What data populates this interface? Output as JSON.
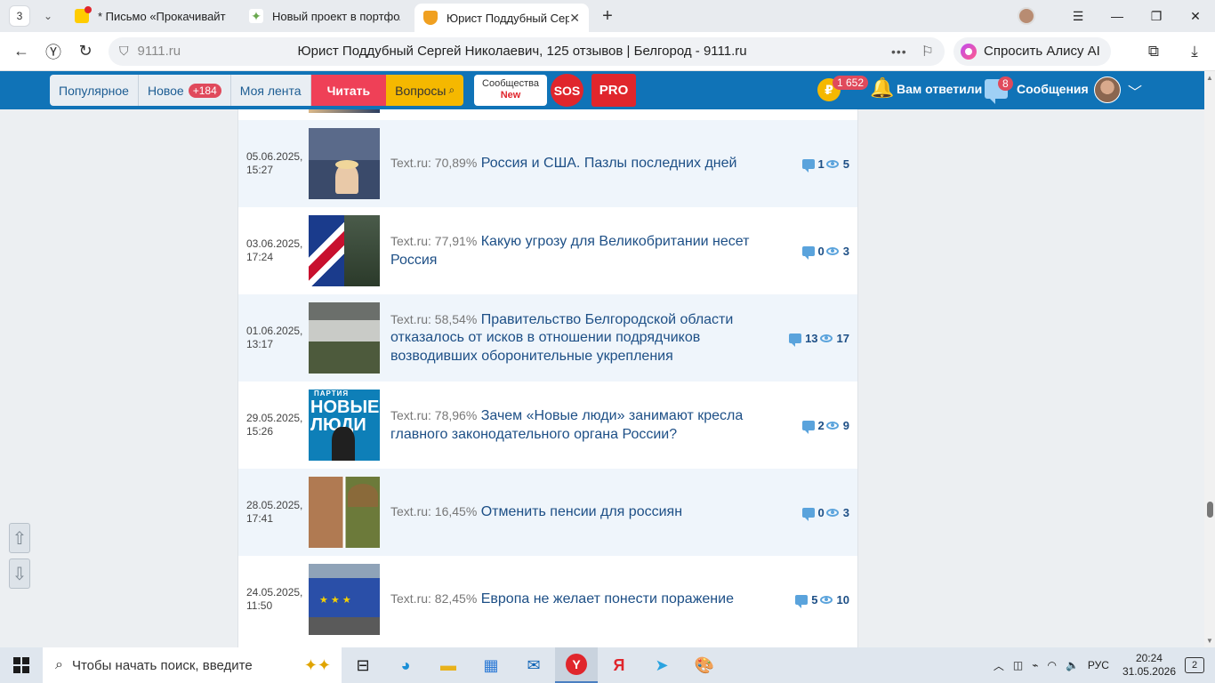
{
  "browser": {
    "tab_count": "3",
    "tabs": [
      {
        "title": "* Письмо «Прокачивайте"
      },
      {
        "title": "Новый проект в портфол"
      },
      {
        "title": "Юрист Поддубный Сергей"
      }
    ],
    "url_host": "9111.ru",
    "page_title": "Юрист Поддубный Сергей Николаевич, 125 отзывов | Белгород - 9111.ru",
    "alice_label": "Спросить Алису AI"
  },
  "nav": {
    "popular": "Популярное",
    "new": "Новое",
    "new_badge": "+184",
    "feed": "Моя лента",
    "read": "Читать",
    "questions": "Вопросы",
    "community_top": "Сообщества",
    "community_new": "New",
    "sos": "SOS",
    "pro": "PRO",
    "coin_symbol": "₽",
    "coin_badge": "1 652",
    "answered": "Вам ответили",
    "messages_badge": "8",
    "messages": "Сообщения"
  },
  "articles": [
    {
      "date": "05.06.2025,",
      "time": "15:27",
      "source": "Text.ru: 70,89%",
      "title": "Россия и США. Пазлы последних дней",
      "comments": "1",
      "views": "5"
    },
    {
      "date": "03.06.2025,",
      "time": "17:24",
      "source": "Text.ru: 77,91%",
      "title": "Какую угрозу для Великобритании несет Россия",
      "comments": "0",
      "views": "3"
    },
    {
      "date": "01.06.2025,",
      "time": "13:17",
      "source": "Text.ru: 58,54%",
      "title": "Правительство Белгородской области отказалось от исков в отношении подрядчиков возводивших оборонительные укрепления",
      "comments": "13",
      "views": "17"
    },
    {
      "date": "29.05.2025,",
      "time": "15:26",
      "source": "Text.ru: 78,96%",
      "title": "Зачем «Новые люди» занимают кресла главного законодательного органа России?",
      "comments": "2",
      "views": "9"
    },
    {
      "date": "28.05.2025,",
      "time": "17:41",
      "source": "Text.ru: 16,45%",
      "title": "Отменить пенсии для россиян",
      "comments": "0",
      "views": "3"
    },
    {
      "date": "24.05.2025,",
      "time": "11:50",
      "source": "Text.ru: 82,45%",
      "title": "Европа не желает понести поражение",
      "comments": "5",
      "views": "10"
    }
  ],
  "thumb4": {
    "line1": "ПАРТИЯ",
    "line2": "НОВЫЕ",
    "line3": "ЛЮДИ"
  },
  "scroll": {
    "up": "⇧",
    "down": "⇩"
  },
  "taskbar": {
    "search_placeholder": "Чтобы начать поиск, введите",
    "lang": "РУС",
    "time": "20:24",
    "date": "31.05.2026",
    "notifications": "2"
  }
}
